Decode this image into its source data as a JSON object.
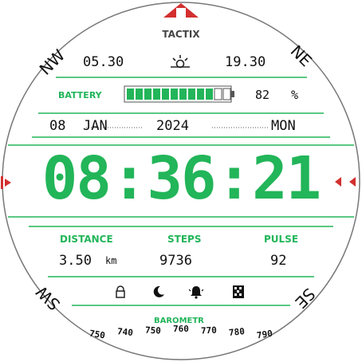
{
  "brand": "TACTIX",
  "compass": {
    "nw": "NW",
    "ne": "NE",
    "sw": "SW",
    "se": "SE"
  },
  "sun": {
    "sunrise": "05.30",
    "sunset": "19.30"
  },
  "battery": {
    "label": "BATTERY",
    "percent": 82,
    "percent_text": "82",
    "unit": "%",
    "segments": 12,
    "filled": 10
  },
  "date": {
    "day": "08",
    "month": "JAN",
    "year": "2024",
    "weekday": "MON"
  },
  "time": {
    "hours": "08",
    "minutes": "36",
    "seconds": "21"
  },
  "metrics": {
    "distance": {
      "label": "DISTANCE",
      "value": "3.50",
      "unit": "km"
    },
    "steps": {
      "label": "STEPS",
      "value": "9736"
    },
    "pulse": {
      "label": "PULSE",
      "value": "92"
    }
  },
  "barometer": {
    "label": "BAROMETR",
    "readings": [
      "750",
      "740",
      "750",
      "760",
      "770",
      "780",
      "790"
    ]
  },
  "status_icons": [
    "lock-icon",
    "moon-icon",
    "bell-icon",
    "pattern-icon"
  ],
  "colors": {
    "accent": "#22b559",
    "marker_red": "#d32f2f",
    "text": "#111111",
    "background": "#ffffff"
  }
}
